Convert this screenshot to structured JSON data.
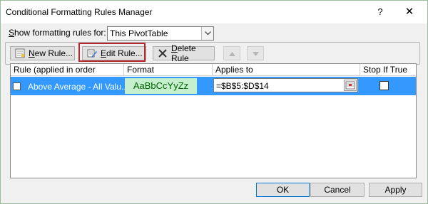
{
  "window": {
    "title": "Conditional Formatting Rules Manager",
    "help_glyph": "?",
    "close_glyph": "✕"
  },
  "show_rules": {
    "label_prefix": "S",
    "label_rest": "how formatting rules for:",
    "selected": "This PivotTable"
  },
  "toolbar": {
    "new_rule_u": "N",
    "new_rule_rest": "ew Rule...",
    "edit_rule_u": "E",
    "edit_rule_rest": "dit Rule...",
    "delete_rule_u": "D",
    "delete_rule_rest": "elete Rule"
  },
  "table": {
    "columns": [
      "Rule (applied in order shown)",
      "Format",
      "Applies to",
      "Stop If True"
    ],
    "rows": [
      {
        "rule": "Above Average - All Valu...",
        "format_preview": "AaBbCcYyZz",
        "applies_to": "=$B$5:$D$14",
        "stop_if_true": false
      }
    ]
  },
  "footer": {
    "ok": "OK",
    "cancel": "Cancel",
    "apply": "Apply"
  },
  "colors": {
    "selection": "#3399ff",
    "format_fill": "#c6efce",
    "format_text": "#006100",
    "highlight_border": "#b3272d"
  },
  "icons": [
    "help-icon",
    "close-icon",
    "dropdown-arrow-icon",
    "new-rule-icon",
    "edit-rule-icon",
    "delete-rule-icon",
    "move-up-icon",
    "move-down-icon",
    "rule-type-icon",
    "range-select-icon"
  ]
}
